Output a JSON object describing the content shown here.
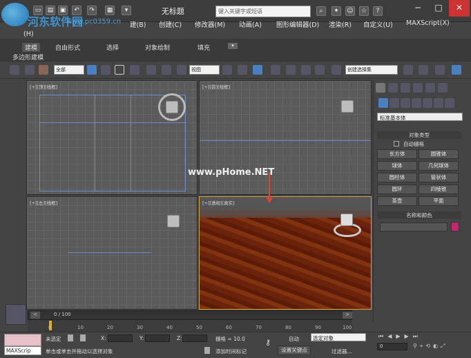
{
  "title_bar": {
    "doc_title": "无标题",
    "search_placeholder": "键入关键字或短语",
    "min": "−",
    "max": "□",
    "close": "✕"
  },
  "watermark": {
    "text1": "河东软件园",
    "text2": "www.pc0359.cn",
    "center": "www.pHome.NET"
  },
  "menu": [
    "(H)",
    "建(B)",
    "创建(C)",
    "修改器(M)",
    "动画(A)",
    "图形编辑器(D)",
    "渲染(R)",
    "自定义(U)",
    "MAXScript(X)"
  ],
  "ribbon": {
    "tabs": [
      "建模",
      "自由形式",
      "选择",
      "对象绘制",
      "填充"
    ],
    "sub": "多边形建模"
  },
  "toolbar": {
    "filter": "全部",
    "refcoord": "视图",
    "named_sel": "创建选择集"
  },
  "viewports": [
    {
      "label": "[+][顶][线框]"
    },
    {
      "label": "[+][前][线框]"
    },
    {
      "label": "[+][左][线框]"
    },
    {
      "label": "[+][透视][真实]"
    }
  ],
  "cmd_panel": {
    "category": "标准基本体",
    "object_type_title": "对象类型",
    "autogrid": "自动栅格",
    "buttons": [
      "长方体",
      "圆锥体",
      "球体",
      "几何球体",
      "圆柱体",
      "管状体",
      "圆环",
      "四棱锥",
      "茶壶",
      "平面"
    ],
    "name_color_title": "名称和颜色"
  },
  "timeline": {
    "frame": "0 / 100",
    "ticks": [
      "0",
      "10",
      "20",
      "30",
      "40",
      "50",
      "60",
      "70",
      "80",
      "90",
      "100"
    ]
  },
  "status": {
    "maxscript": "MAXScrip",
    "none_selected": "未选定",
    "x": "X:",
    "y": "Y:",
    "z": "Z:",
    "grid": "栅格 = 10.0",
    "auto": "自动",
    "sel_obj": "选定对象",
    "set_key": "设置关键点",
    "filters": "过滤器...",
    "prompt": "单击或单击并拖动以选择对象",
    "add_tag": "添加时间标记",
    "frame_val": "0"
  }
}
